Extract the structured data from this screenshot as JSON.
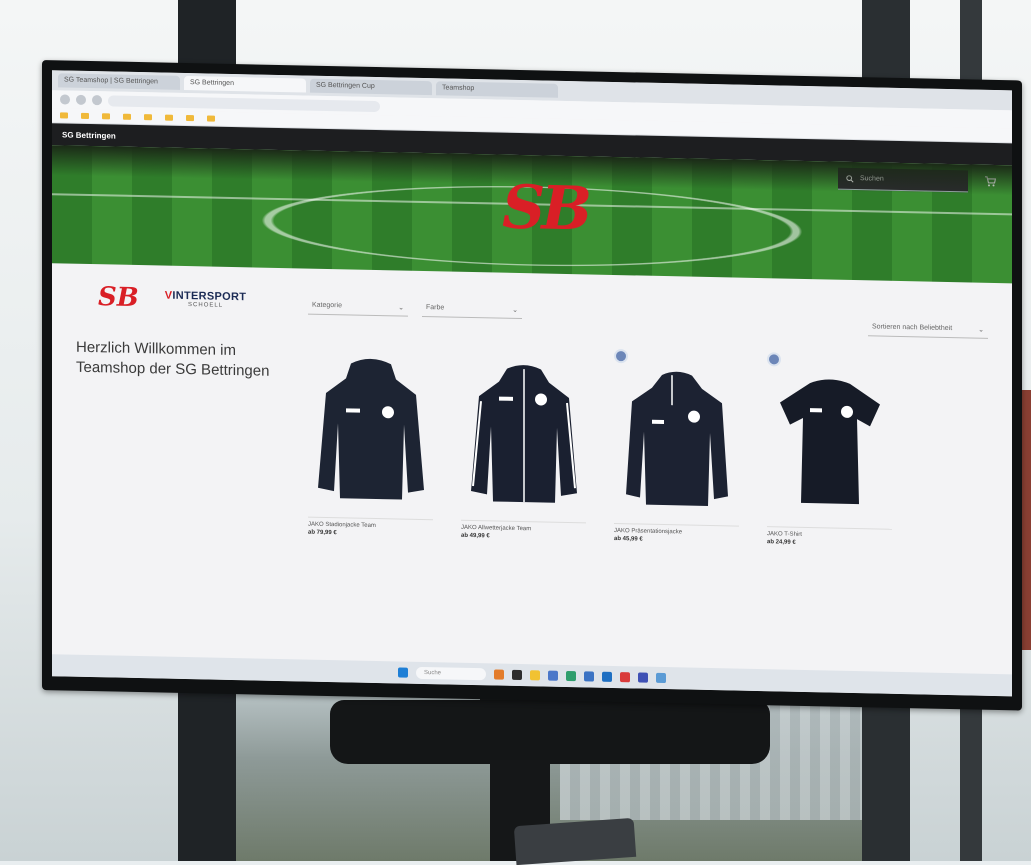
{
  "browser": {
    "tabs": [
      {
        "label": "SG Teamshop | SG Bettringen",
        "active": false
      },
      {
        "label": "SG Bettringen",
        "active": true
      },
      {
        "label": "SG Bettringen Cup",
        "active": false
      },
      {
        "label": "Teamshop",
        "active": false
      }
    ],
    "url": "",
    "bookmarks": [
      "",
      "",
      "",
      "",
      "",
      "",
      "",
      "",
      "",
      ""
    ]
  },
  "site": {
    "top_title": "SG Bettringen",
    "hero_logo": "SB",
    "search_placeholder": "Suchen",
    "cart_icon": "cart-icon",
    "sidebar": {
      "logo_text": "SB",
      "partner_brand": "INTERSPORT",
      "partner_sub": "SCHOELL",
      "welcome": "Herzlich Willkommen im Teamshop der SG Bettringen",
      "info": [
        "",
        "",
        "",
        ""
      ]
    },
    "filters": {
      "select1": "Kategorie",
      "select2": "Farbe",
      "sort": "Sortieren nach Beliebtheit"
    },
    "products": [
      {
        "name": "JAKO Stadionjacke Team",
        "price": "ab 79,99 €",
        "badge": false,
        "color": "#1d2433"
      },
      {
        "name": "JAKO Allwetterjacke Team",
        "price": "ab 49,99 €",
        "badge": false,
        "color": "#1a2030"
      },
      {
        "name": "JAKO Präsentationsjacke",
        "price": "ab 45,99 €",
        "badge": true,
        "color": "#1c2232"
      },
      {
        "name": "JAKO T-Shirt",
        "price": "ab 24,99 €",
        "badge": true,
        "color": "#161b27"
      }
    ]
  },
  "taskbar": {
    "search_label": "Suche",
    "icons": [
      "#1e7fd6",
      "#e37c2b",
      "#2d2d2d",
      "#f1c232",
      "#4a77c9",
      "#2f9e6d",
      "#3b73c4",
      "#1e6fc2",
      "#d93b3b",
      "#3f51b5",
      "#5b9bd5"
    ]
  },
  "colors": {
    "brand_red": "#d91f26",
    "header_dark": "#1d1e20",
    "grass": "#3b8f33"
  }
}
